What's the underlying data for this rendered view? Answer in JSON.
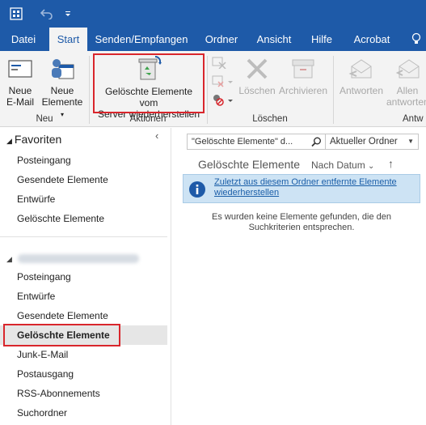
{
  "quick_access": {
    "app_icon": "outlook-sendreceive-all-icon",
    "undo_icon": "undo-icon",
    "customize_icon": "chevron-down-icon"
  },
  "tabs": [
    "Datei",
    "Start",
    "Senden/Empfangen",
    "Ordner",
    "Ansicht",
    "Hilfe",
    "Acrobat"
  ],
  "tab_active": "Start",
  "tell_me_icon": "lightbulb-icon",
  "ribbon": {
    "new_email_label_1": "Neue",
    "new_email_label_2": "E-Mail",
    "new_items_label_1": "Neue",
    "new_items_label_2": "Elemente",
    "group_new": "Neu",
    "recover_label_1": "Gelöschte Elemente vom",
    "recover_label_2": "Server wiederherstellen",
    "group_actions": "Aktionen",
    "delete_label": "Löschen",
    "archive_label": "Archivieren",
    "group_delete": "Löschen",
    "reply_label": "Antworten",
    "reply_all_label_1": "Allen",
    "reply_all_label_2": "antworten",
    "group_respond": "Antw"
  },
  "left_pane": {
    "favorites_title": "Favoriten",
    "favorites": [
      "Posteingang",
      "Gesendete Elemente",
      "Entwürfe",
      "Gelöschte Elemente"
    ],
    "account_items": [
      "Posteingang",
      "Entwürfe",
      "Gesendete Elemente",
      "Gelöschte Elemente",
      "Junk-E-Mail",
      "Postausgang",
      "RSS-Abonnements",
      "Suchordner"
    ],
    "selected_item": "Gelöschte Elemente"
  },
  "right_pane": {
    "search_value": "\"Gelöschte Elemente\" d...",
    "scope_value": "Aktueller Ordner",
    "folder_title": "Gelöschte Elemente",
    "sort_label": "Nach Datum",
    "info_link_1": "Zuletzt aus diesem Ordner entfernte Elemente",
    "info_link_2": "wiederherstellen",
    "empty_msg_1": "Es wurden keine Elemente gefunden, die den",
    "empty_msg_2": "Suchkriterien entsprechen."
  },
  "colors": {
    "brand": "#1e5aa8",
    "highlight_red": "#d9262c",
    "info_bg": "#cde3f4",
    "link": "#1a5ea8"
  }
}
